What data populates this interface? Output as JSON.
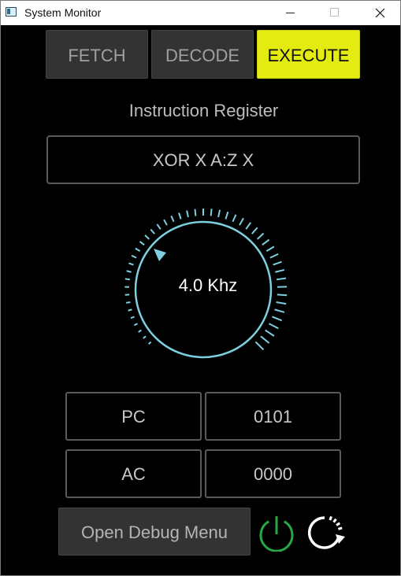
{
  "window": {
    "title": "System Monitor",
    "icon": "app-window-icon",
    "controls": [
      "minimize-icon",
      "maximize-icon",
      "close-icon"
    ]
  },
  "stages": [
    {
      "label": "FETCH",
      "active": false
    },
    {
      "label": "DECODE",
      "active": false
    },
    {
      "label": "EXECUTE",
      "active": true
    }
  ],
  "instruction_register": {
    "label": "Instruction Register",
    "value": "XOR X A:Z X"
  },
  "clock": {
    "value_text": "4.0 Khz",
    "accent_color": "#7ecfe0"
  },
  "registers": [
    {
      "name": "PC",
      "value": "0101"
    },
    {
      "name": "AC",
      "value": "0000"
    }
  ],
  "footer": {
    "debug_label": "Open Debug Menu",
    "power_icon": "power-icon",
    "power_color": "#27a844",
    "reset_icon": "reset-icon"
  },
  "colors": {
    "active_stage": "#e4eb10",
    "inactive_stage": "#333333",
    "background": "#000000"
  }
}
